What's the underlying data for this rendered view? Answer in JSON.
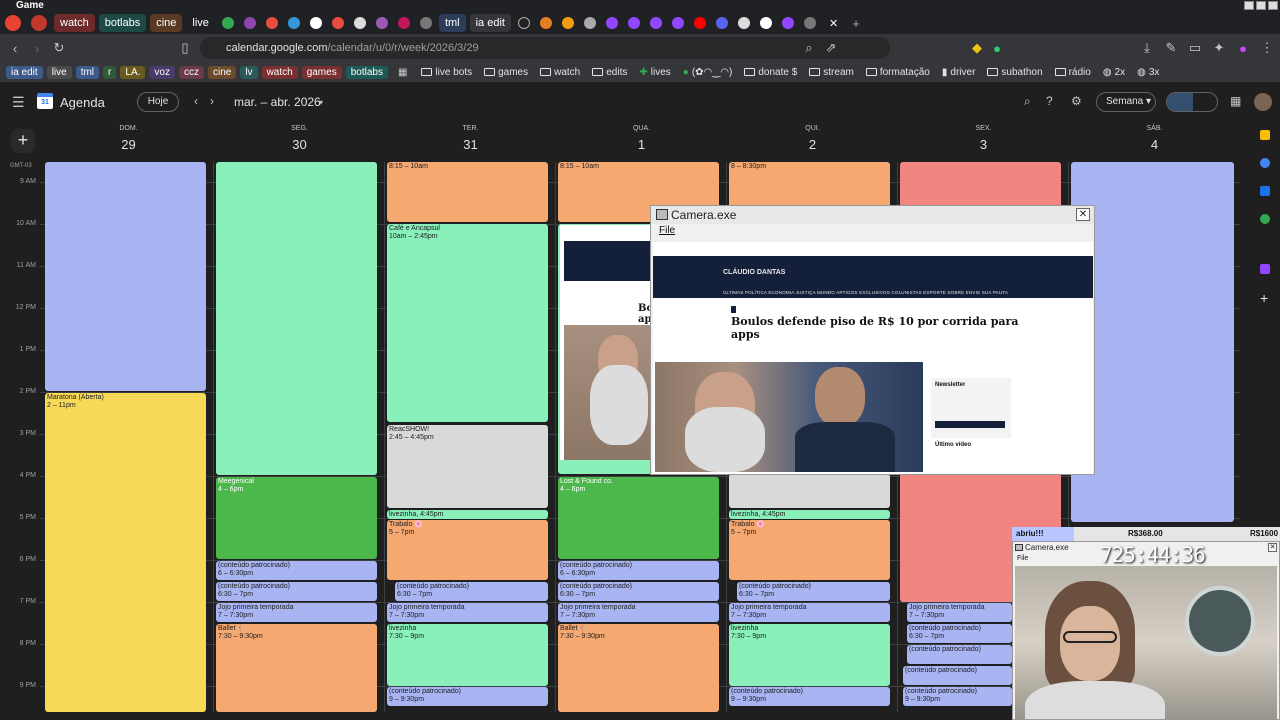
{
  "window": {
    "title": "Game"
  },
  "tabs": [
    {
      "label": "watch",
      "style": "red"
    },
    {
      "label": "botlabs",
      "style": "teal"
    },
    {
      "label": "cine",
      "style": "brown"
    },
    {
      "label": "live",
      "style": "plain"
    },
    {
      "label": "tml",
      "style": "blue"
    },
    {
      "label": "ia edit",
      "style": "active"
    }
  ],
  "address": {
    "host": "calendar.google.com",
    "path": "/calendar/u/0/r/week/2026/3/29"
  },
  "bookmarks": {
    "chips": [
      "ia edit",
      "live",
      "tml",
      "r",
      "LA.",
      "voz",
      "ccz",
      "cine",
      "lv",
      "watch",
      "games",
      "botlabs"
    ],
    "folders": [
      "live bots",
      "games",
      "watch",
      "edits",
      "lives",
      "(✿◠‿◠)",
      "donate $",
      "stream",
      "formatação",
      "driver",
      "subathon",
      "rádio",
      "2x",
      "3x"
    ]
  },
  "calendar": {
    "app_name": "Agenda",
    "today_label": "Hoje",
    "period": "mar. – abr. 2026",
    "view_label": "Semana",
    "timezone": "GMT-03",
    "days": [
      {
        "name": "DOM.",
        "date": "29"
      },
      {
        "name": "SEG.",
        "date": "30"
      },
      {
        "name": "TER.",
        "date": "31"
      },
      {
        "name": "QUA.",
        "date": "1"
      },
      {
        "name": "QUI.",
        "date": "2"
      },
      {
        "name": "SEX.",
        "date": "3"
      },
      {
        "name": "SÁB.",
        "date": "4"
      }
    ],
    "hours": [
      "9 AM",
      "10 AM",
      "11 AM",
      "12 PM",
      "1 PM",
      "2 PM",
      "3 PM",
      "4 PM",
      "5 PM",
      "6 PM",
      "7 PM",
      "8 PM",
      "9 PM"
    ],
    "events": [
      {
        "id": "e1",
        "name": "Maratona (Aberta)",
        "time": "2 – 11pm",
        "color": "yellow"
      },
      {
        "id": "e2",
        "name": "8:15 – 10am",
        "time": "",
        "color": "orange"
      },
      {
        "id": "e3",
        "name": "Café e Ancapsul",
        "time": "10am – 2:45pm",
        "color": "green"
      },
      {
        "id": "e4",
        "name": "ReacSHOW!",
        "time": "2:45 – 4:45pm",
        "color": "gray"
      },
      {
        "id": "e5",
        "name": "Meegenical",
        "time": "4 – 6pm",
        "color": "dgreen"
      },
      {
        "id": "e6",
        "name": "livezinha, 4:45pm",
        "time": "",
        "color": "green"
      },
      {
        "id": "e7",
        "name": "Trabalo 🌸",
        "time": "5 – 7pm",
        "color": "orange"
      },
      {
        "id": "e8",
        "name": "(conteúdo patrocinado)",
        "time": "6 – 6:30pm",
        "color": "blue"
      },
      {
        "id": "e9",
        "name": "(conteúdo patrocinado)",
        "time": "6:30 – 7pm",
        "color": "blue"
      },
      {
        "id": "e10",
        "name": "Jojo primeira temporada",
        "time": "7 – 7:30pm",
        "color": "blue"
      },
      {
        "id": "e11",
        "name": "Ballet 🩰",
        "time": "7:30 – 9:30pm",
        "color": "orange"
      },
      {
        "id": "e12",
        "name": "livezinha",
        "time": "7:30 – 9pm",
        "color": "green"
      },
      {
        "id": "e13",
        "name": "(conteúdo patrocinado)",
        "time": "9 – 9:30pm",
        "color": "blue"
      },
      {
        "id": "e14",
        "name": "Lost & Found co.",
        "time": "4 – 6pm",
        "color": "dgreen"
      },
      {
        "id": "e15",
        "name": "8:15 – 10am",
        "time": "",
        "color": "orange"
      },
      {
        "id": "e16",
        "name": "8 – 8:30pm",
        "time": "",
        "color": "blue"
      }
    ]
  },
  "camera_window": {
    "title": "Camera.exe",
    "menu": "File",
    "site_logo": "CLÁUDIO DANTAS",
    "site_nav": "ÚLTIMAS  POLÍTICA  ECONOMIA  JUSTIÇA  MUNDO  ARTIGOS EXCLUSIVOS  COLUNISTAS  ESPORTE  SOBRE  ENVIE SUA PAUTA",
    "headline": "Boulos defende piso de R$ 10 por corrida para apps",
    "newsletter": "Newsletter",
    "video_label": "Último vídeo",
    "bg_headline": "Bo ap"
  },
  "stream_widgets": {
    "goal_label": "abriu!!!",
    "goal_current": "R$368.00",
    "goal_target": "R$1600",
    "goal_progress": 0.23,
    "timer": "725:44:36",
    "cam_title": "Camera.exe",
    "cam_menu": "File"
  },
  "colors": {
    "yellow": "#f7d958",
    "orange": "#f5a870",
    "green": "#88f0b8",
    "blue": "#a8b5f2",
    "red": "#f28482",
    "gray": "#d9d9d9",
    "dgreen": "#4cb84c"
  }
}
